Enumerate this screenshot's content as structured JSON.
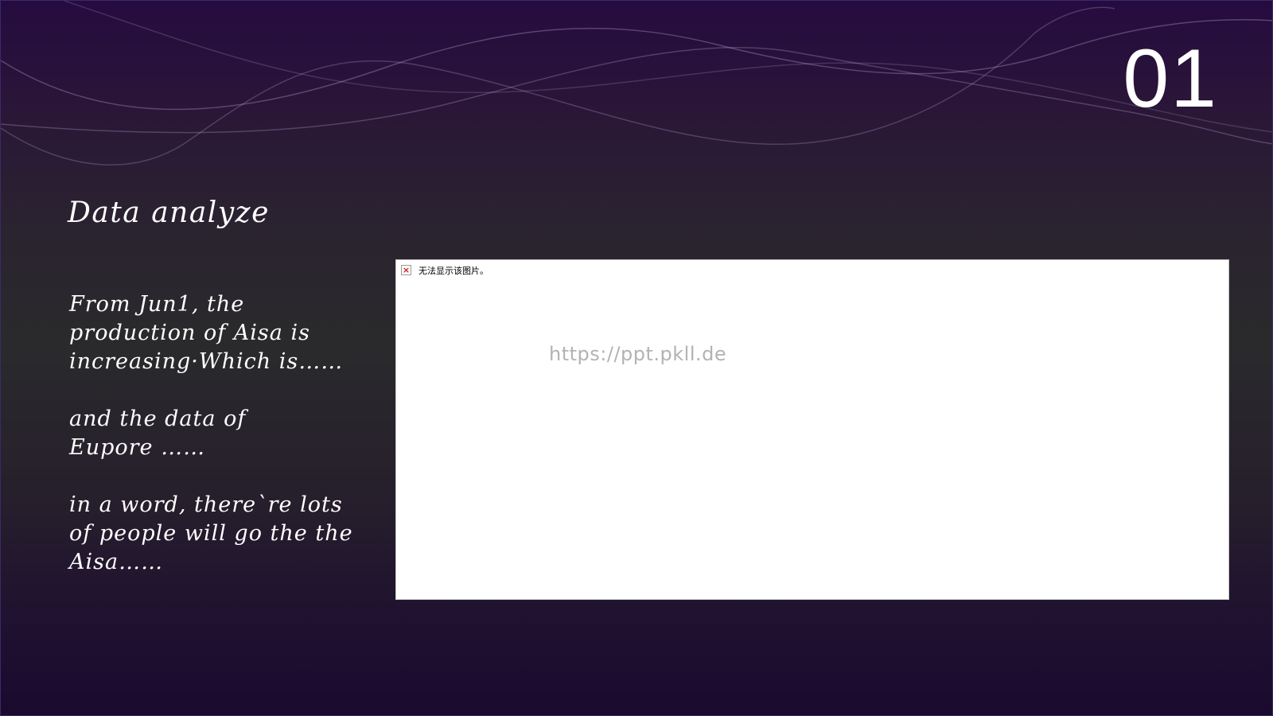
{
  "slide": {
    "number": "01",
    "title": "Data analyze",
    "paragraphs": [
      "From Jun1, the\nproduction  of Aisa is\nincreasing·Which is……",
      "and the data of\nEupore ……",
      "in a word, there`re lots\nof people will go the the\nAisa……"
    ]
  },
  "image_placeholder": {
    "icon": "broken-image-icon",
    "message": "无法显示该图片。",
    "watermark": "https://ppt.pkll.de"
  },
  "colors": {
    "background_top": "#250b40",
    "background_mid": "#2a2a2c",
    "background_bottom": "#1a0a2e",
    "text": "#ffffff",
    "icon_x": "#d21a1a"
  }
}
